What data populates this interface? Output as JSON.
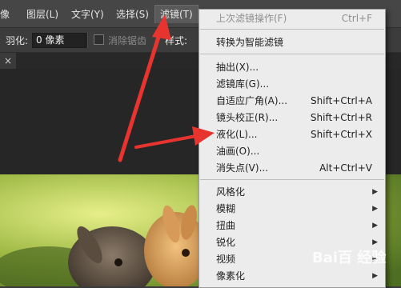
{
  "menubar": {
    "items": [
      "像",
      "图层(L)",
      "文字(Y)",
      "选择(S)",
      "滤镜(T)"
    ]
  },
  "options": {
    "feather_label": "羽化:",
    "feather_value": "0 像素",
    "antialias_label": "消除锯齿",
    "style_label": "样式:"
  },
  "tab": {
    "close": "×"
  },
  "filter_menu": {
    "last_filter": {
      "label": "上次滤镜操作(F)",
      "shortcut": "Ctrl+F"
    },
    "convert_smart": "转换为智能滤镜",
    "extract": "抽出(X)...",
    "gallery": "滤镜库(G)...",
    "adaptive_wide": {
      "label": "自适应广角(A)...",
      "shortcut": "Shift+Ctrl+A"
    },
    "lens_correction": {
      "label": "镜头校正(R)...",
      "shortcut": "Shift+Ctrl+R"
    },
    "liquify": {
      "label": "液化(L)...",
      "shortcut": "Shift+Ctrl+X"
    },
    "oil_paint": "油画(O)...",
    "vanishing_point": {
      "label": "消失点(V)...",
      "shortcut": "Alt+Ctrl+V"
    },
    "submenus": [
      "风格化",
      "模糊",
      "扭曲",
      "锐化",
      "视频",
      "像素化"
    ]
  },
  "watermark": {
    "text": "Bai百 经验"
  },
  "colors": {
    "annotation_arrow": "#e8342f",
    "menu_bg": "#ececec",
    "menubar_bg": "#464646"
  }
}
